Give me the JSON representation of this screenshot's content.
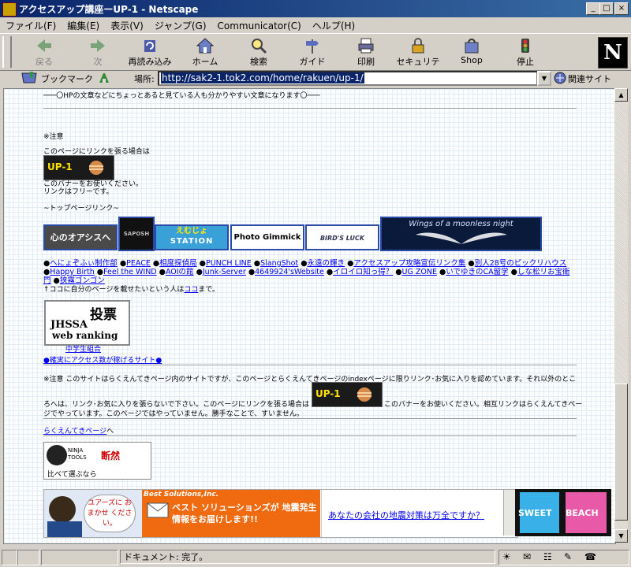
{
  "window": {
    "title": "アクセスアップ講座ーUP-1 - Netscape",
    "controls": {
      "minimize": "_",
      "maximize": "□",
      "close": "×"
    }
  },
  "menu": [
    "ファイル(F)",
    "編集(E)",
    "表示(V)",
    "ジャンプ(G)",
    "Communicator(C)",
    "ヘルプ(H)"
  ],
  "toolbar": {
    "back": "戻る",
    "forward": "次",
    "reload": "再読み込み",
    "home": "ホーム",
    "search": "検索",
    "guide": "ガイド",
    "print": "印刷",
    "security": "セキュリティ",
    "shop": "Shop",
    "stop": "停止",
    "logo": "N"
  },
  "location": {
    "bookmarks": "ブックマーク",
    "label": "場所:",
    "url": "http://sak2-1.tok2.com/home/rakuen/up-1/",
    "related": "関連サイト"
  },
  "page": {
    "intro_line": "───〇HPの文章などにちょっとあると見ている人も分かりやすい文章になります〇───",
    "notice_title": "※注意",
    "notice_link": "このページにリンクを張る場合は",
    "banner_label": "UP-1",
    "use_banner": "このバナーをお使いください。",
    "link_free": "リンクはフリーです。",
    "toplink_header": "~トップページリンク~",
    "banners": {
      "kokoro": "心のオアシスへ",
      "saposh": "SAPOSH",
      "emujo_top": "えむじょ",
      "emujo_bottom": "STATION",
      "photo": "Photo Gimmick",
      "birds": "BIRD'S LUCK",
      "wings": "Wings of a moonless night"
    },
    "site_links": [
      "へにょぞふぃ制作部",
      "PEACE",
      "相度探偵局",
      "PUNCH LINE",
      "SlangShot",
      "永遠の輝き",
      "アクセスアップ攻略宣伝リンク集",
      "別人28号のピックリハウス",
      "Happy Birth",
      "Feel the WIND",
      "AOIの館",
      "Junk-Server",
      "4649924'sWebsite",
      "イロイロ知っ得？",
      "UG ZONE",
      "いでゆきのCA留学",
      "しな松リお宝衛門",
      "狭霧ゴンゴン"
    ],
    "want_listed_prefix": "↑ココに自分のページを載せたいという人は",
    "want_listed_link": "ココ",
    "want_listed_suffix": "まで。",
    "ranking": {
      "title": "投票",
      "org": "JHSSA",
      "sub": "web ranking",
      "caption": "中学生組合"
    },
    "sure_access": "●確実にアクセス数が稼げるサイト●",
    "notice2_title": "※注意",
    "notice2_line1": "このサイトはらくえんてきページ内のサイトですが、このページとらくえんてきページのindexページに限りリンク･お気に入りを認めています。それ以外のとこ",
    "notice2_line2a": "ろへは、リンク･お気に入りを張らないで下さい。このページにリンクを張る場合は",
    "notice2_line2b": "このバナーをお使いください。相互リンクはらくえんてきペー",
    "notice2_line3": "ジでやっています。このページではやっていません。勝手なことで、すいません。",
    "rakuen_link": "らくえんてきページ",
    "rakuen_suffix": "へ",
    "ninja": {
      "brand": "NINJA TOOLS",
      "tag": "断然",
      "caption": "比べて選ぶなら"
    },
    "ad": {
      "speech": "ユアーズに おまかせ ください。",
      "company": "Best Solutions,Inc.",
      "headline": "ベスト ソリューションズが 地震発生情報をお届けします!!",
      "question": "あなたの会社の地震対策は万全ですか？"
    },
    "sweet_beach": {
      "left": "SWEET",
      "right": "BEACH"
    }
  },
  "status": {
    "text": "ドキュメント: 完了。"
  }
}
